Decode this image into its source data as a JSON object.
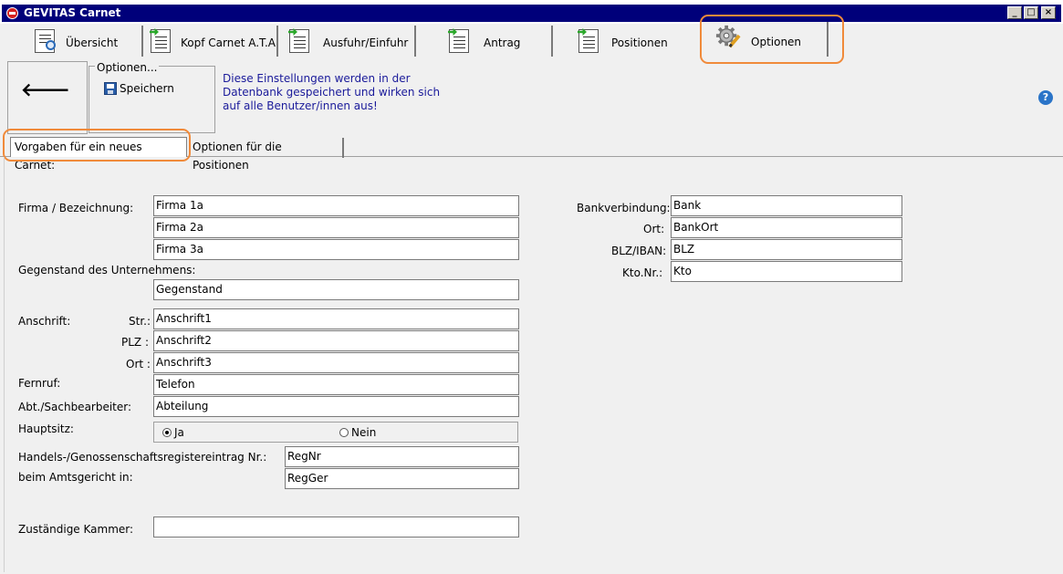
{
  "window": {
    "title": "GEVITAS Carnet",
    "minimize": "_",
    "maximize": "□",
    "close": "×"
  },
  "main_tabs": [
    {
      "label": "Übersicht",
      "icon": "magnifier-list-icon"
    },
    {
      "label": "Kopf Carnet A.T.A",
      "icon": "document-arrow-icon"
    },
    {
      "label": "Ausfuhr/Einfuhr",
      "icon": "document-arrow-icon"
    },
    {
      "label": "Antrag",
      "icon": "document-arrow-icon"
    },
    {
      "label": "Positionen",
      "icon": "document-arrow-icon"
    },
    {
      "label": "Optionen",
      "icon": "gear-pencil-icon",
      "selected": true
    }
  ],
  "toolbar": {
    "back_icon": "arrow-left-icon",
    "group_label": "Optionen...",
    "save_label": "Speichern",
    "info": "Diese Einstellungen werden in der Datenbank gespeichert und wirken sich auf alle Benutzer/innen aus!",
    "help": "?"
  },
  "sub_tabs": [
    {
      "label": "Vorgaben für ein neues Carnet:",
      "selected": true
    },
    {
      "label": "Optionen für die Positionen",
      "selected": false
    }
  ],
  "form": {
    "firma_label": "Firma / Bezeichnung:",
    "firma1": "Firma 1a",
    "firma2": "Firma 2a",
    "firma3": "Firma 3a",
    "gegenstand_label": "Gegenstand des Unternehmens:",
    "gegenstand": "Gegenstand",
    "anschrift_label": "Anschrift:",
    "str_label": "Str.:",
    "plz_label": "PLZ :",
    "ort_label": "Ort :",
    "anschrift1": "Anschrift1",
    "anschrift2": "Anschrift2",
    "anschrift3": "Anschrift3",
    "fernruf_label": "Fernruf:",
    "telefon": "Telefon",
    "abteilung_label": "Abt./Sachbearbeiter:",
    "abteilung": "Abteilung",
    "hauptsitz_label": "Hauptsitz:",
    "hauptsitz_ja": "Ja",
    "hauptsitz_nein": "Nein",
    "hauptsitz_value": "Ja",
    "register_label": "Handels-/Genossenschaftsregistereintrag Nr.:",
    "regnr": "RegNr",
    "amtsgericht_label": "beim Amtsgericht in:",
    "regger": "RegGer",
    "kammer_label": "Zuständige Kammer:",
    "kammer": "",
    "bank_label": "Bankverbindung:",
    "bank": "Bank",
    "bankort_label": "Ort:",
    "bankort": "BankOrt",
    "blz_label": "BLZ/IBAN:",
    "blz": "BLZ",
    "kto_label": "Kto.Nr.:",
    "kto": "Kto"
  },
  "colors": {
    "titlebar": "#00007a",
    "info_text": "#1a1a9a",
    "highlight": "#f08a3a"
  }
}
